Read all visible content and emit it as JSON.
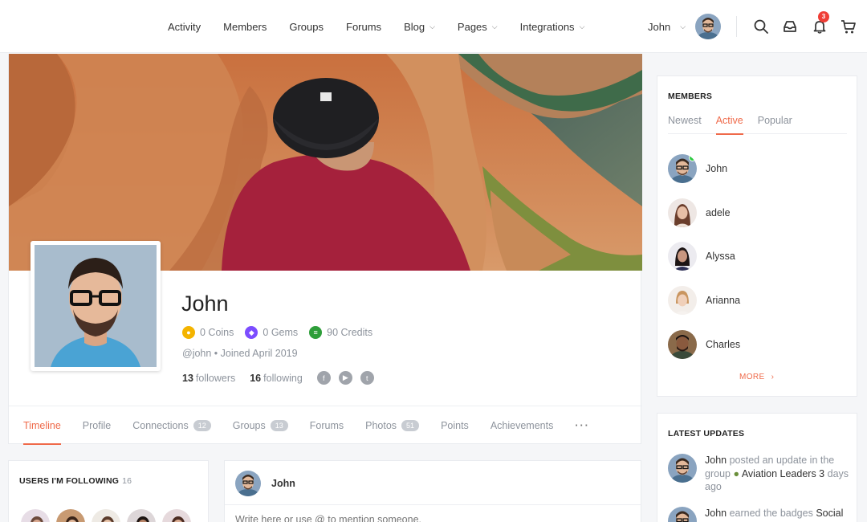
{
  "nav": {
    "items": [
      {
        "label": "Activity"
      },
      {
        "label": "Members"
      },
      {
        "label": "Groups"
      },
      {
        "label": "Forums"
      },
      {
        "label": "Blog",
        "dropdown": true
      },
      {
        "label": "Pages",
        "dropdown": true
      },
      {
        "label": "Integrations",
        "dropdown": true
      }
    ]
  },
  "header": {
    "user_name": "John",
    "notification_count": "3",
    "icons": [
      "search-icon",
      "inbox-icon",
      "bell-icon",
      "cart-icon"
    ]
  },
  "profile": {
    "name": "John",
    "coins": "0 Coins",
    "gems": "0 Gems",
    "credits": "90 Credits",
    "handle_line": "@john • Joined April 2019",
    "followers_count": "13",
    "followers_label": "followers",
    "following_count": "16",
    "following_label": "following",
    "social_icons": [
      "facebook-icon",
      "youtube-icon",
      "twitter-icon"
    ]
  },
  "tabs": [
    {
      "label": "Timeline",
      "active": true
    },
    {
      "label": "Profile"
    },
    {
      "label": "Connections",
      "count": "12"
    },
    {
      "label": "Groups",
      "count": "13"
    },
    {
      "label": "Forums"
    },
    {
      "label": "Photos",
      "count": "51"
    },
    {
      "label": "Points"
    },
    {
      "label": "Achievements"
    },
    {
      "label": "···"
    }
  ],
  "following_widget": {
    "title": "USERS I'M FOLLOWING",
    "count": "16"
  },
  "post_box": {
    "author": "John",
    "placeholder": "Write here or use @ to mention someone."
  },
  "members_widget": {
    "title": "MEMBERS",
    "tabs": [
      {
        "label": "Newest"
      },
      {
        "label": "Active",
        "active": true
      },
      {
        "label": "Popular"
      }
    ],
    "members": [
      {
        "name": "John",
        "online": true
      },
      {
        "name": "adele"
      },
      {
        "name": "Alyssa"
      },
      {
        "name": "Arianna"
      },
      {
        "name": "Charles"
      }
    ],
    "more_label": "MORE"
  },
  "updates_widget": {
    "title": "LATEST UPDATES",
    "items": [
      {
        "actor": "John",
        "text": " posted an update in the group ",
        "target": "Aviation Leaders 3",
        "time": "days ago"
      },
      {
        "actor": "John",
        "text": " earned the badges ",
        "target": "Social"
      }
    ]
  },
  "colors": {
    "accent": "#ef6a4a",
    "online": "#2ecc40",
    "badge": "#ef3e36",
    "coin": "#f4b400",
    "gem": "#7c4dff",
    "credit": "#2e9e3a"
  }
}
